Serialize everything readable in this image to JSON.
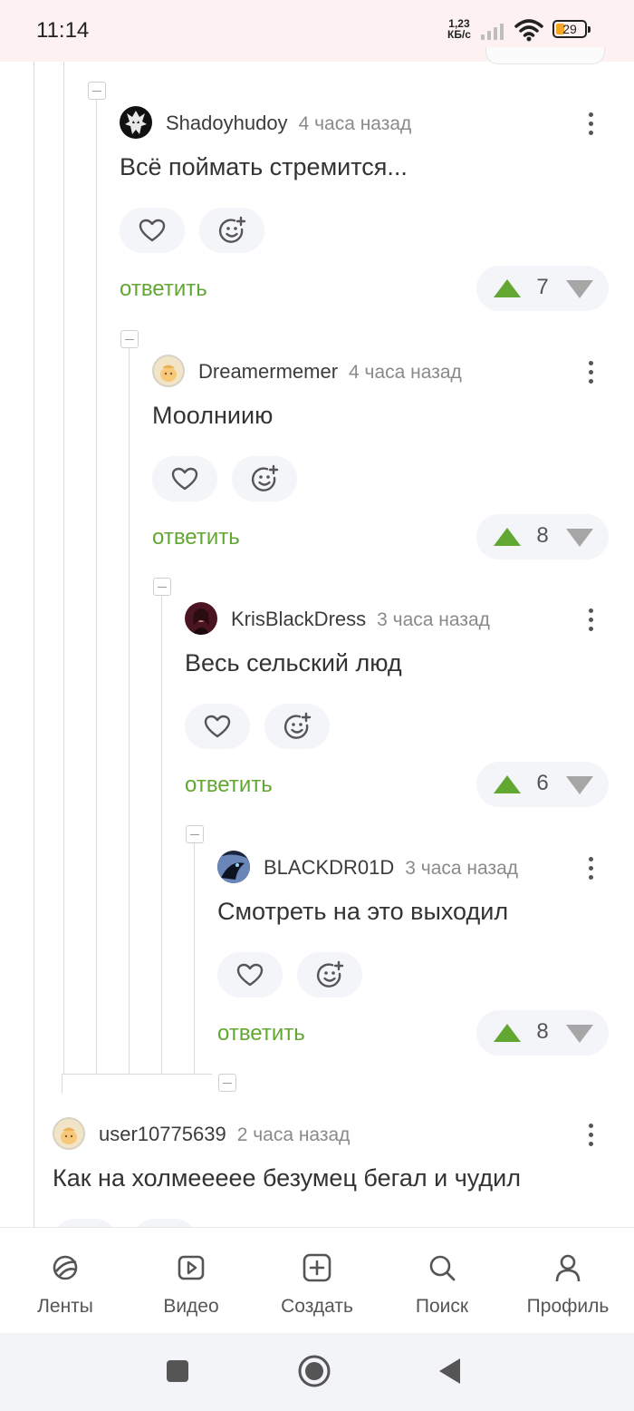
{
  "status_bar": {
    "time": "11:14",
    "speed_value": "1,23",
    "speed_unit": "КБ/с",
    "battery": "29"
  },
  "comments": [
    {
      "author": "Shadoyhudoy",
      "time": "4 часа назад",
      "text": "Всё поймать стремится...",
      "reply_label": "ответить",
      "rating": "7"
    },
    {
      "author": "Dreamermemer",
      "time": "4 часа назад",
      "text": "Моолниию",
      "reply_label": "ответить",
      "rating": "8"
    },
    {
      "author": "KrisBlackDress",
      "time": "3 часа назад",
      "text": "Весь сельский люд",
      "reply_label": "ответить",
      "rating": "6"
    },
    {
      "author": "BLACKDR01D",
      "time": "3 часа назад",
      "text": "Смотреть на это выходил",
      "reply_label": "ответить",
      "rating": "8"
    },
    {
      "author": "user10775639",
      "time": "2 часа назад",
      "text": "Как на холмеееее безумец бегал и чудил"
    }
  ],
  "bottom_nav": [
    {
      "label": "Ленты",
      "icon": "feeds-icon"
    },
    {
      "label": "Видео",
      "icon": "video-icon"
    },
    {
      "label": "Создать",
      "icon": "create-icon"
    },
    {
      "label": "Поиск",
      "icon": "search-icon"
    },
    {
      "label": "Профиль",
      "icon": "profile-icon"
    }
  ],
  "colors": {
    "accent_green": "#63a733",
    "vote_down_grey": "#a6a6a6",
    "status_bar_bg": "#fdf2f1"
  }
}
